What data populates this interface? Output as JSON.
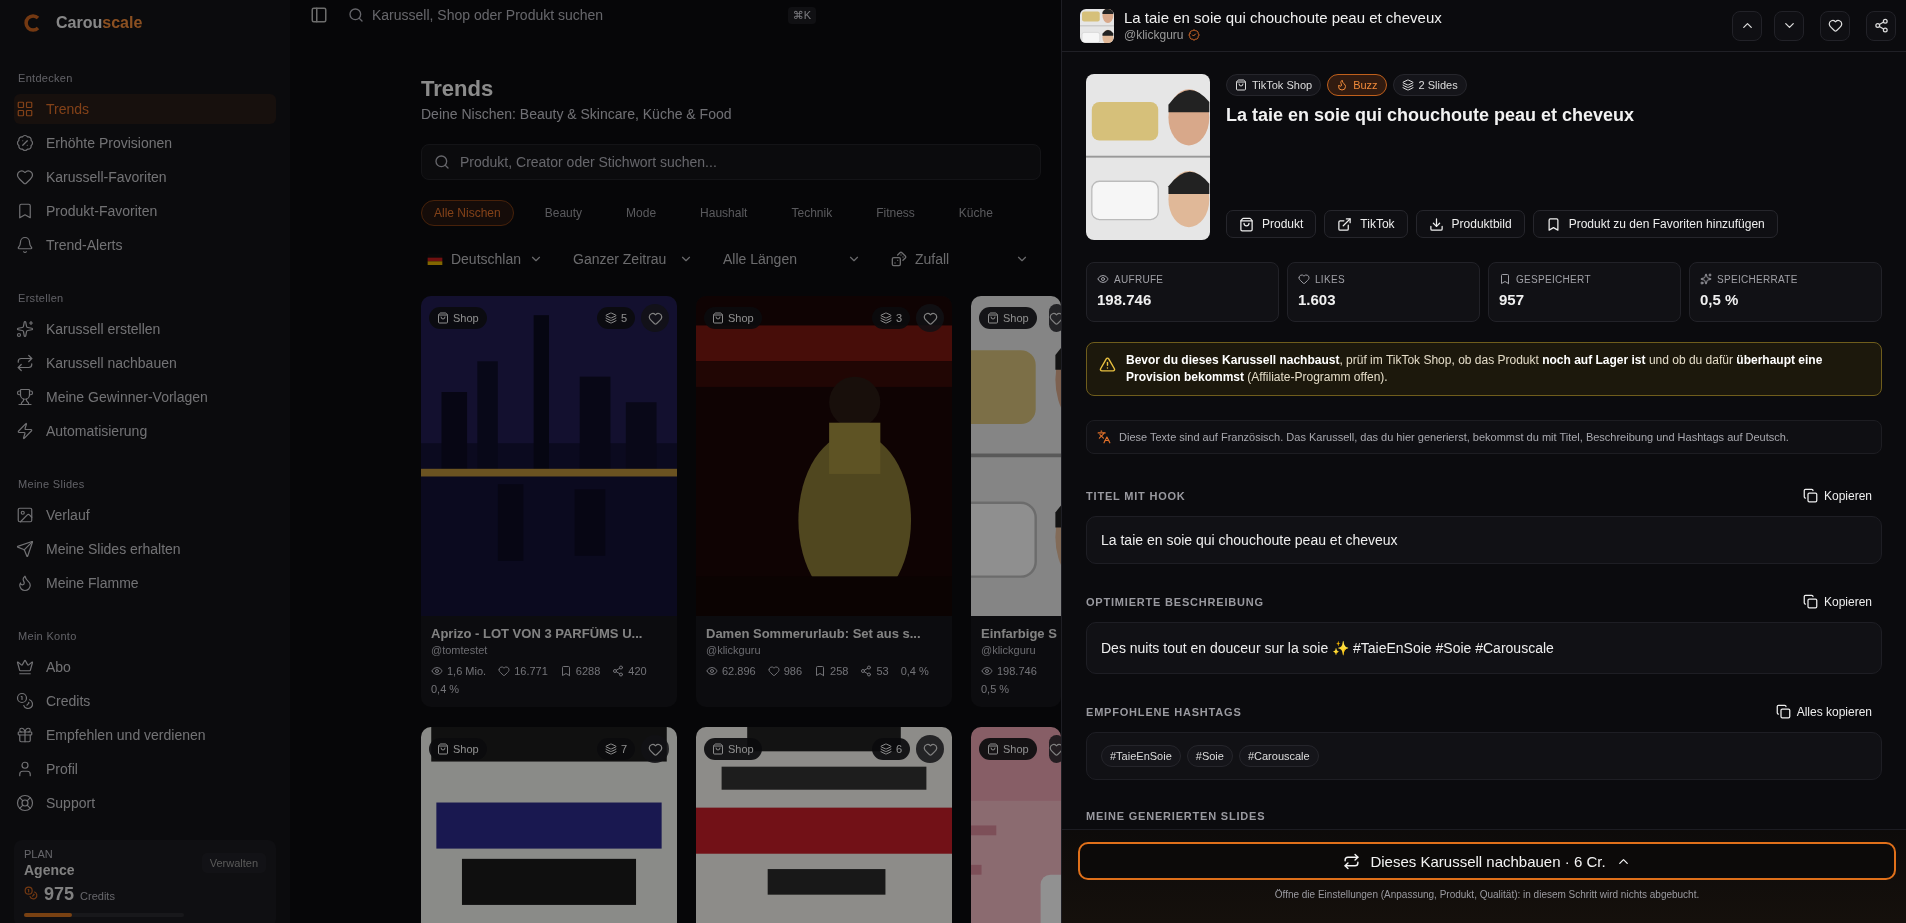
{
  "sidebar": {
    "logo": [
      "Carou",
      "scale"
    ],
    "sections": [
      {
        "title": "Entdecken",
        "items": [
          {
            "label": "Trends",
            "selected": true
          },
          {
            "label": "Erhöhte Provisionen",
            "selected": false
          },
          {
            "label": "Karussell-Favoriten",
            "selected": false
          },
          {
            "label": "Produkt-Favoriten",
            "selected": false
          },
          {
            "label": "Trend-Alerts",
            "selected": false
          }
        ]
      },
      {
        "title": "Erstellen",
        "items": [
          {
            "label": "Karussell erstellen",
            "selected": false
          },
          {
            "label": "Karussell nachbauen",
            "selected": false
          },
          {
            "label": "Meine Gewinner-Vorlagen",
            "selected": false
          },
          {
            "label": "Automatisierung",
            "selected": false
          }
        ]
      },
      {
        "title": "Meine Slides",
        "items": [
          {
            "label": "Verlauf",
            "selected": false
          },
          {
            "label": "Meine Slides erhalten",
            "selected": false
          },
          {
            "label": "Meine Flamme",
            "selected": false
          }
        ]
      },
      {
        "title": "Mein Konto",
        "items": [
          {
            "label": "Abo",
            "selected": false
          },
          {
            "label": "Credits",
            "selected": false
          },
          {
            "label": "Empfehlen und verdienen",
            "selected": false
          },
          {
            "label": "Profil",
            "selected": false
          },
          {
            "label": "Support",
            "selected": false
          }
        ]
      }
    ],
    "plan": {
      "label": "PLAN",
      "name": "Agence",
      "manage": "Verwalten",
      "credits": "975",
      "credits_label": "Credits",
      "level": 0.3
    }
  },
  "topbar": {
    "search_placeholder": "Karussell, Shop oder Produkt suchen",
    "shortcut": "⌘K"
  },
  "main": {
    "title": "Trends",
    "subtitle": "Deine Nischen: Beauty & Skincare, Küche & Food",
    "search_placeholder": "Produkt, Creator oder Stichwort suchen...",
    "chips": [
      {
        "label": "Alle Nischen",
        "selected": true
      },
      {
        "label": "Beauty",
        "selected": false
      },
      {
        "label": "Mode",
        "selected": false
      },
      {
        "label": "Haushalt",
        "selected": false
      },
      {
        "label": "Technik",
        "selected": false
      },
      {
        "label": "Fitness",
        "selected": false
      },
      {
        "label": "Küche",
        "selected": false
      }
    ],
    "filters": [
      {
        "label": "Deutschlan",
        "kind": "flag"
      },
      {
        "label": "Ganzer Zeitrau",
        "kind": "plain"
      },
      {
        "label": "Alle Längen",
        "kind": "plain"
      },
      {
        "label": "Zufall",
        "kind": "dice"
      }
    ],
    "cards": [
      {
        "shop": "Shop",
        "slides": "5",
        "title": "Aprizo - LOT VON 3 PARFÜMS U...",
        "handle": "@tomtestet",
        "stats": [
          {
            "kind": "views",
            "value": "1,6 Mio."
          },
          {
            "kind": "likes",
            "value": "16.771"
          },
          {
            "kind": "saves",
            "value": "6288"
          },
          {
            "kind": "shares",
            "value": "420"
          },
          {
            "kind": "rate",
            "value": "0,4 %"
          }
        ]
      },
      {
        "shop": "Shop",
        "slides": "3",
        "title": "Damen Sommerurlaub: Set aus s...",
        "handle": "@klickguru",
        "stats": [
          {
            "kind": "views",
            "value": "62.896"
          },
          {
            "kind": "likes",
            "value": "986"
          },
          {
            "kind": "saves",
            "value": "258"
          },
          {
            "kind": "shares",
            "value": "53"
          },
          {
            "kind": "rate",
            "value": "0,4 %"
          }
        ]
      },
      {
        "shop": "Shop",
        "title": "Einfarbige S",
        "handle": "@klickguru",
        "stats": [
          {
            "kind": "views",
            "value": "198.746"
          },
          {
            "kind": "rate",
            "value": "0,5 %"
          }
        ]
      },
      {
        "shop": "Shop",
        "slides": "7"
      },
      {
        "shop": "Shop",
        "slides": "6"
      },
      {
        "shop": "Shop"
      }
    ]
  },
  "drawer": {
    "header": {
      "title": "La taie en soie qui chouchoute peau et cheveux",
      "handle": "@klickguru"
    },
    "badges": [
      {
        "label": "TikTok Shop",
        "kind": "shop"
      },
      {
        "label": "Buzz",
        "kind": "buzz"
      },
      {
        "label": "2 Slides",
        "kind": "slides"
      }
    ],
    "title": "La taie en soie qui chouchoute peau et cheveux",
    "actions": [
      {
        "label": "Produkt",
        "kind": "bag"
      },
      {
        "label": "TikTok",
        "kind": "external"
      },
      {
        "label": "Produktbild",
        "kind": "download"
      },
      {
        "label": "Produkt zu den Favoriten hinzufügen",
        "kind": "bookmark"
      }
    ],
    "stats": [
      {
        "label": "AUFRUFE",
        "value": "198.746",
        "kind": "views"
      },
      {
        "label": "LIKES",
        "value": "1.603",
        "kind": "likes"
      },
      {
        "label": "GESPEICHERT",
        "value": "957",
        "kind": "saves"
      },
      {
        "label": "SPEICHERRATE",
        "value": "0,5 %",
        "kind": "rate"
      }
    ],
    "warning": "**Bevor du dieses Karussell nachbaust**, prüf im TikTok Shop, ob das Produkt **noch auf Lager ist** und ob du dafür **überhaupt eine Provision bekommst** (Affiliate-Programm offen).",
    "note": "Diese Texte sind auf Französisch. Das Karussell, das du hier generierst, bekommst du mit Titel, Beschreibung und Hashtags auf Deutsch.",
    "sections": [
      {
        "kind": "text",
        "heading": "TITEL MIT HOOK",
        "copy": "Kopieren",
        "text": "La taie en soie qui chouchoute peau et cheveux"
      },
      {
        "kind": "text",
        "heading": "OPTIMIERTE BESCHREIBUNG",
        "copy": "Kopieren",
        "text": "Des nuits tout en douceur sur la soie ✨ #TaieEnSoie #Soie #Carouscale"
      },
      {
        "kind": "tags",
        "heading": "EMPFOHLENE HASHTAGS",
        "copy": "Alles kopieren",
        "tags": [
          "#TaieEnSoie",
          "#Soie",
          "#Carouscale"
        ]
      },
      {
        "kind": "heading",
        "heading": "MEINE GENERIERTEN SLIDES"
      }
    ],
    "cta": "Dieses Karussell nachbauen · 6 Cr.",
    "hint": "Öffne die Einstellungen (Anpassung, Produkt, Qualität): in diesem Schritt wird nichts abgebucht."
  }
}
